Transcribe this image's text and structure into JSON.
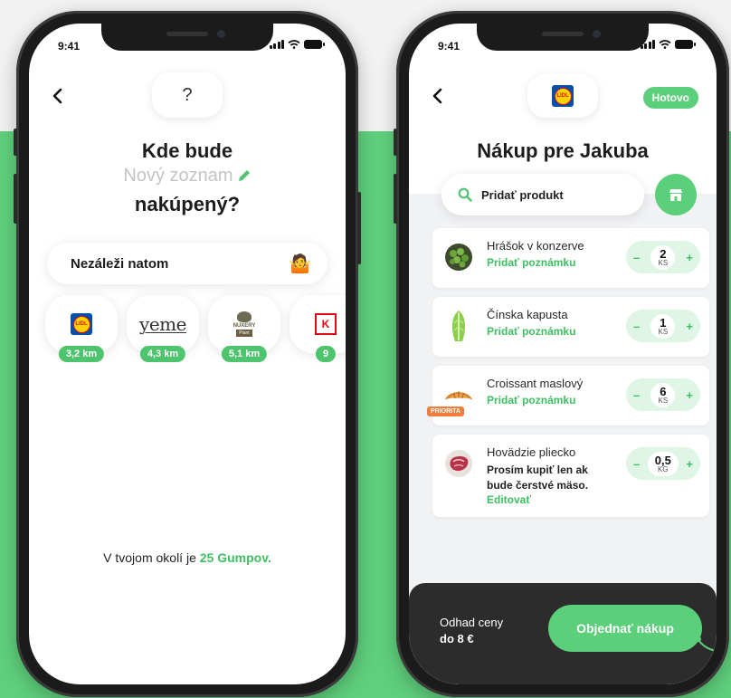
{
  "status_time": "9:41",
  "left": {
    "top_pill": "?",
    "title": "Kde bude",
    "subtitle": "Nový zoznam",
    "title2": "nakúpený?",
    "any_option": "Nezáleži natom",
    "stores": [
      {
        "name": "Lidl",
        "logo_text": "LIDL",
        "distance": "3,2 km"
      },
      {
        "name": "yeme",
        "logo_text": "yeme",
        "distance": "4,3 km"
      },
      {
        "name": "Nuxery",
        "logo_text": "NUXERY",
        "logo_tag": "Plant",
        "distance": "5,1 km"
      },
      {
        "name": "Kaufland",
        "logo_text": "K",
        "distance": "9"
      }
    ],
    "footer_prefix": "V tvojom okolí je ",
    "footer_highlight": "25 Gumpov."
  },
  "right": {
    "store_logo_text": "LIDL",
    "done_label": "Hotovo",
    "title": "Nákup pre Jakuba",
    "search_placeholder": "Pridať produkt",
    "items": [
      {
        "name": "Hrášok v konzerve",
        "note": "Pridať poznámku",
        "qty": "2",
        "unit": "KS"
      },
      {
        "name": "Čínska kapusta",
        "note": "Pridať poznámku",
        "qty": "1",
        "unit": "KS"
      },
      {
        "name": "Croissant maslový",
        "note": "Pridať poznámku",
        "qty": "6",
        "unit": "KS",
        "badge": "PRIORITA"
      },
      {
        "name": "Hovädzie pliecko",
        "note_text": "Prosím kupiť len ak bude čerstvé mäso.",
        "edit": "Editovať",
        "qty": "0,5",
        "unit": "KG"
      }
    ],
    "stepper_minus": "–",
    "stepper_plus": "+",
    "estimate_label": "Odhad ceny",
    "estimate_value": "do 8 €",
    "order_label": "Objednať nákup"
  },
  "colors": {
    "accent_green": "#5ccf7a",
    "background_green": "#5fcf7c",
    "priority_orange": "#f07d3b",
    "dark_bar": "#2c2c2c"
  }
}
